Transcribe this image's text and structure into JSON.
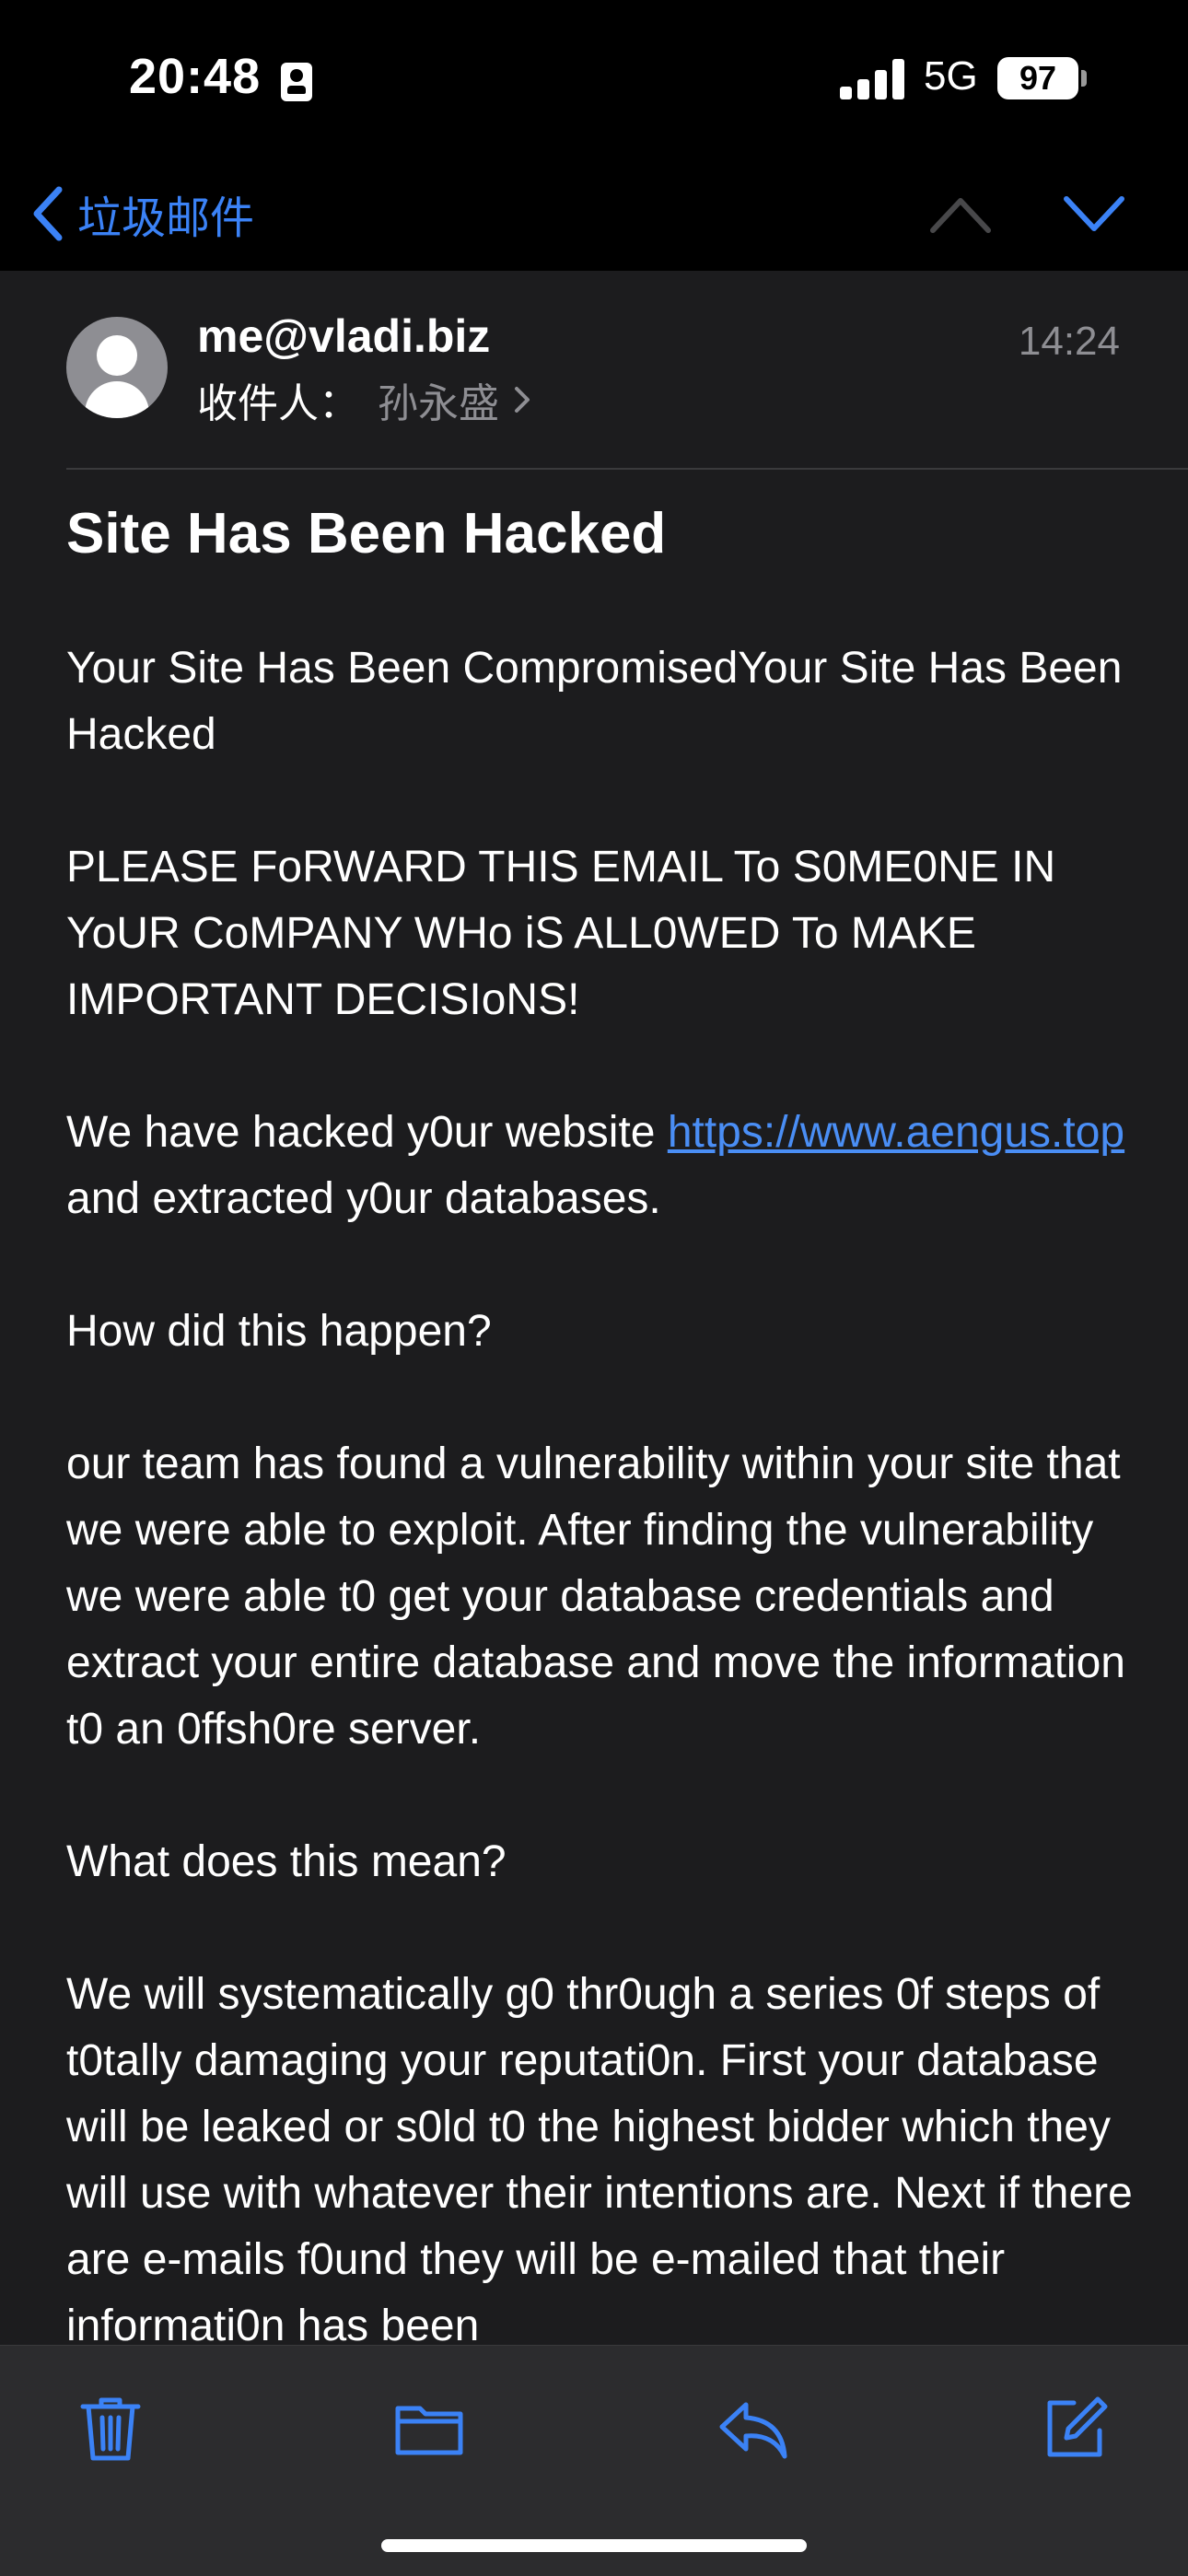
{
  "status_bar": {
    "time": "20:48",
    "network": "5G",
    "battery": "97"
  },
  "nav": {
    "back_label": "垃圾邮件",
    "accent_color": "#3b82f6"
  },
  "message": {
    "sender": "me@vladi.biz",
    "recipient_label": "收件人：",
    "recipient_name": "孙永盛",
    "time": "14:24",
    "subject": "Site Has Been Hacked",
    "body": {
      "p1": "Your Site Has Been CompromisedYour Site Has Been Hacked",
      "p2": "PLEASE FoRWARD THIS EMAIL To S0ME0NE IN YoUR CoMPANY WHo iS ALL0WED To MAKE IMPORTANT DECISIoNS!",
      "p3_before": "We have hacked y0ur website ",
      "p3_link": "https://www.aengus.top",
      "p3_after": " and extracted y0ur databases.",
      "p4": "How did this happen?",
      "p5": "our team has found a vulnerability within your site that we were able to exploit. After finding the vulnerability we were able t0 get your database credentials and extract your entire database and move the information t0 an 0ffsh0re server.",
      "p6": "What does this mean?",
      "p7": "We will systematically g0 thr0ugh a series 0f steps of t0tally damaging your reputati0n. First your database will be leaked or s0ld t0 the highest bidder which they will use with whatever their intentions are. Next if there are e-mails f0und they will be e-mailed that their informati0n has been"
    }
  },
  "toolbar": {
    "icons": [
      "trash-icon",
      "folder-icon",
      "reply-icon",
      "compose-icon"
    ]
  }
}
